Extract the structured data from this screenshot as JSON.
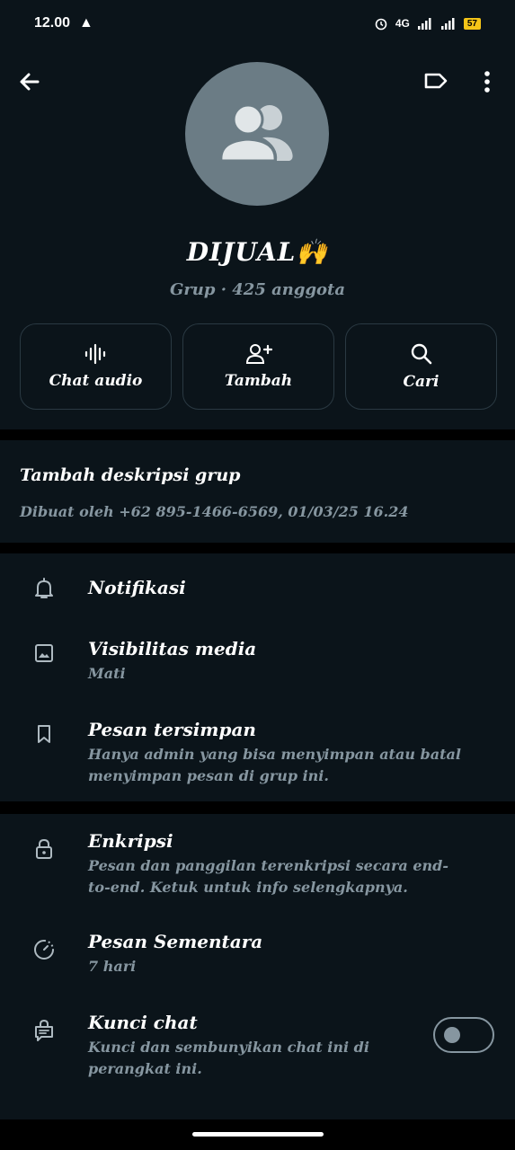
{
  "status_bar": {
    "time": "12.00",
    "network": "4G",
    "battery": "57"
  },
  "header": {
    "group_name": "DIJUAL🙌",
    "group_meta": "Grup · 425 anggota"
  },
  "actions": [
    {
      "label": "Chat audio",
      "icon": "audio-wave-icon"
    },
    {
      "label": "Tambah",
      "icon": "add-person-icon"
    },
    {
      "label": "Cari",
      "icon": "search-icon"
    }
  ],
  "description": {
    "title": "Tambah deskripsi grup",
    "created": "Dibuat oleh +62 895-1466-6569, 01/03/25 16.24"
  },
  "settings_group_1": [
    {
      "title": "Notifikasi",
      "icon": "bell-icon"
    },
    {
      "title": "Visibilitas media",
      "subtitle": "Mati",
      "icon": "image-icon"
    },
    {
      "title": "Pesan tersimpan",
      "subtitle": "Hanya admin yang bisa menyimpan atau batal menyimpan pesan di grup ini.",
      "icon": "bookmark-icon"
    }
  ],
  "settings_group_2": [
    {
      "title": "Enkripsi",
      "subtitle": "Pesan dan panggilan terenkripsi secara end-to-end. Ketuk untuk info selengkapnya.",
      "icon": "lock-icon"
    },
    {
      "title": "Pesan Sementara",
      "subtitle": "7 hari",
      "icon": "timer-icon"
    },
    {
      "title": "Kunci chat",
      "subtitle": "Kunci dan sembunyikan chat ini di perangkat ini.",
      "icon": "chat-lock-icon",
      "toggle_on": false
    }
  ],
  "colors": {
    "background": "#0b141a",
    "text_primary": "#ffffff",
    "text_secondary": "#8696a0",
    "avatar_bg": "#6b7c85"
  }
}
